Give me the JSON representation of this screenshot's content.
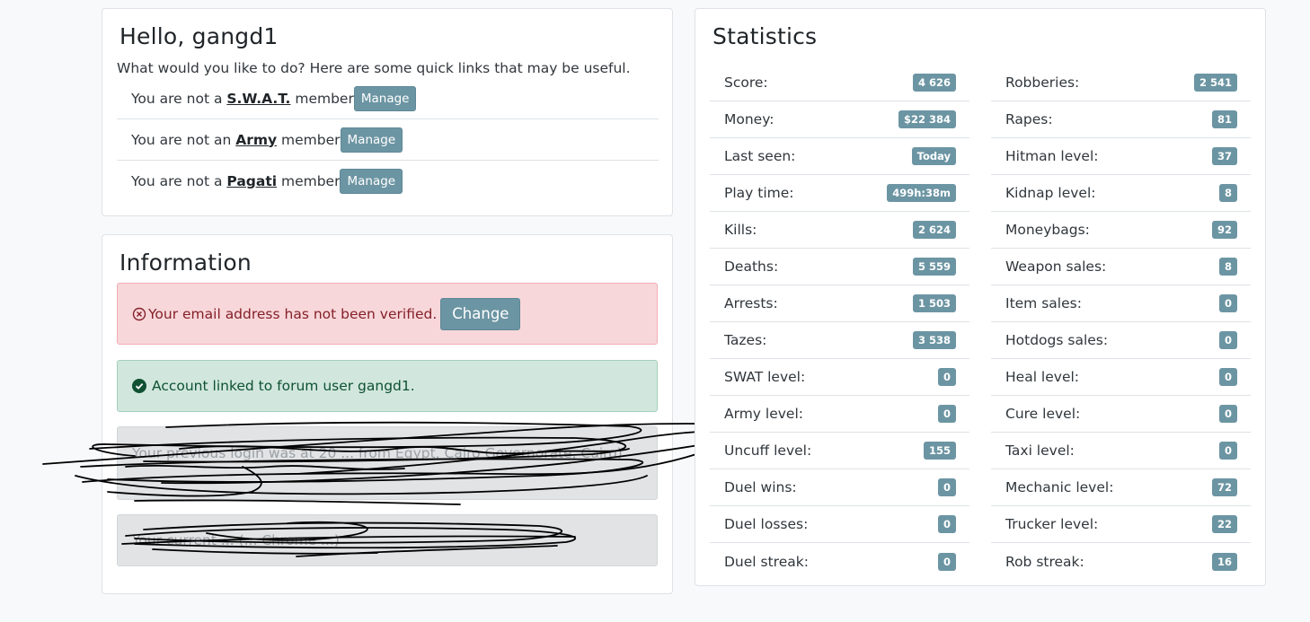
{
  "hello": {
    "title": "Hello, gangd1",
    "intro": "What would you like to do? Here are some quick links that may be useful.",
    "rows": [
      {
        "prefix": "You are not a ",
        "org": "S.W.A.T.",
        "suffix": " member",
        "button": "Manage"
      },
      {
        "prefix": "You are not an ",
        "org": "Army",
        "suffix": " member",
        "button": "Manage"
      },
      {
        "prefix": "You are not a ",
        "org": "Pagati",
        "suffix": " member",
        "button": "Manage"
      }
    ]
  },
  "info": {
    "title": "Information",
    "email_alert": "Your email address has not been verified.",
    "email_button": "Change",
    "forum_alert": "Account linked to forum user gangd1.",
    "redacted_1": "Your previous login was at 20 ... from Egypt, Cairo Governorate, Cairo)",
    "redacted_2": "Your current ... (... Chrome ...)"
  },
  "stats": {
    "title": "Statistics",
    "left": [
      {
        "label": "Score:",
        "value": "4 626"
      },
      {
        "label": "Money:",
        "value": "$22 384"
      },
      {
        "label": "Last seen:",
        "value": "Today"
      },
      {
        "label": "Play time:",
        "value": "499h:38m"
      },
      {
        "label": "Kills:",
        "value": "2 624"
      },
      {
        "label": "Deaths:",
        "value": "5 559"
      },
      {
        "label": "Arrests:",
        "value": "1 503"
      },
      {
        "label": "Tazes:",
        "value": "3 538"
      },
      {
        "label": "SWAT level:",
        "value": "0"
      },
      {
        "label": "Army level:",
        "value": "0"
      },
      {
        "label": "Uncuff level:",
        "value": "155"
      },
      {
        "label": "Duel wins:",
        "value": "0"
      },
      {
        "label": "Duel losses:",
        "value": "0"
      },
      {
        "label": "Duel streak:",
        "value": "0"
      }
    ],
    "right": [
      {
        "label": "Robberies:",
        "value": "2 541"
      },
      {
        "label": "Rapes:",
        "value": "81"
      },
      {
        "label": "Hitman level:",
        "value": "37"
      },
      {
        "label": "Kidnap level:",
        "value": "8"
      },
      {
        "label": "Moneybags:",
        "value": "92"
      },
      {
        "label": "Weapon sales:",
        "value": "8"
      },
      {
        "label": "Item sales:",
        "value": "0"
      },
      {
        "label": "Hotdogs sales:",
        "value": "0"
      },
      {
        "label": "Heal level:",
        "value": "0"
      },
      {
        "label": "Cure level:",
        "value": "0"
      },
      {
        "label": "Taxi level:",
        "value": "0"
      },
      {
        "label": "Mechanic level:",
        "value": "72"
      },
      {
        "label": "Trucker level:",
        "value": "22"
      },
      {
        "label": "Rob streak:",
        "value": "16"
      }
    ]
  },
  "colors": {
    "accent": "#6c95a3",
    "danger_bg": "#f8d7da",
    "success_bg": "#d1e7dd"
  }
}
